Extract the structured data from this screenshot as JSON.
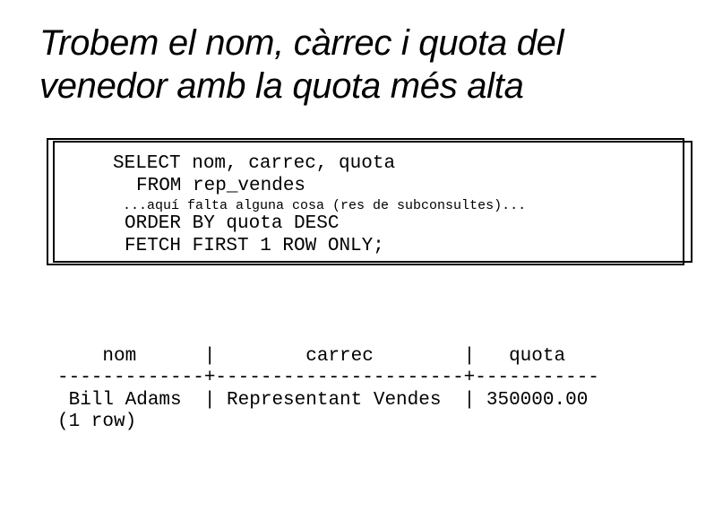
{
  "slide": {
    "title_lines": [
      "Trobem el nom, càrrec i quota del",
      "venedor amb la quota més alta"
    ]
  },
  "code_box": {
    "lines": [
      "SELECT nom, carrec, quota",
      "FROM rep_vendes",
      "...aquí falta alguna cosa (res de subconsultes)...",
      "ORDER BY quota DESC",
      "FETCH FIRST 1 ROW ONLY;"
    ]
  },
  "query_result": {
    "header_line": "    nom      |        carrec        |   quota",
    "separator_line": "-------------+----------------------+-----------",
    "row_line": " Bill Adams  | Representant Vendes  | 350000.00",
    "footer": "(1 row)",
    "columns": [
      "nom",
      "carrec",
      "quota"
    ],
    "rows": [
      [
        "Bill Adams",
        "Representant Vendes",
        "350000.00"
      ]
    ]
  }
}
